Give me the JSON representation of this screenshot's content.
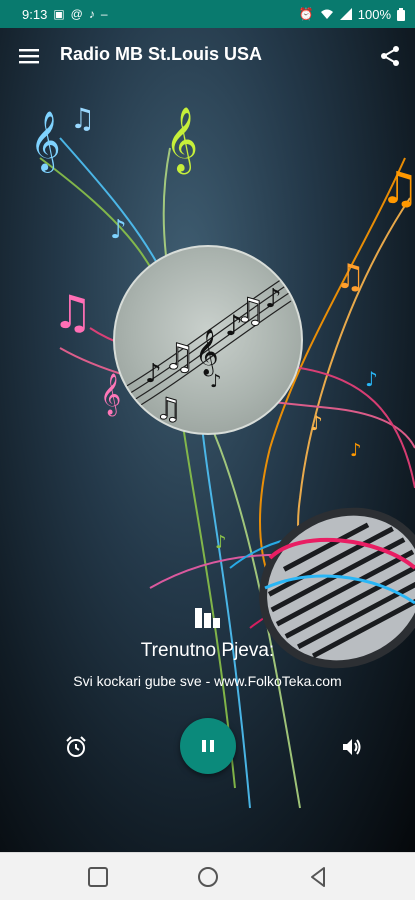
{
  "status_bar": {
    "time": "9:13",
    "battery": "100%",
    "left_icons": [
      "gallery-icon",
      "at-icon",
      "music-note-icon",
      "dash-icon"
    ],
    "right_icons": [
      "alarm-icon",
      "wifi-icon",
      "signal-icon",
      "battery-icon"
    ]
  },
  "toolbar": {
    "title": "Radio MB St.Louis USA",
    "menu_icon": "hamburger-menu-icon",
    "share_icon": "share-icon"
  },
  "now_playing": {
    "label": "Trenutno Pjeva:",
    "track": "Svi kockari gube sve - www.FolkoTeka.com"
  },
  "controls": {
    "alarm_icon": "alarm-clock-icon",
    "play_state": "pause-icon",
    "volume_icon": "volume-icon"
  },
  "colors": {
    "accent": "#0b8a7b",
    "status_bar": "#097a6e",
    "text": "#ffffff"
  },
  "nav_bar": {
    "buttons": [
      "recent-apps-icon",
      "home-icon",
      "back-icon"
    ]
  }
}
